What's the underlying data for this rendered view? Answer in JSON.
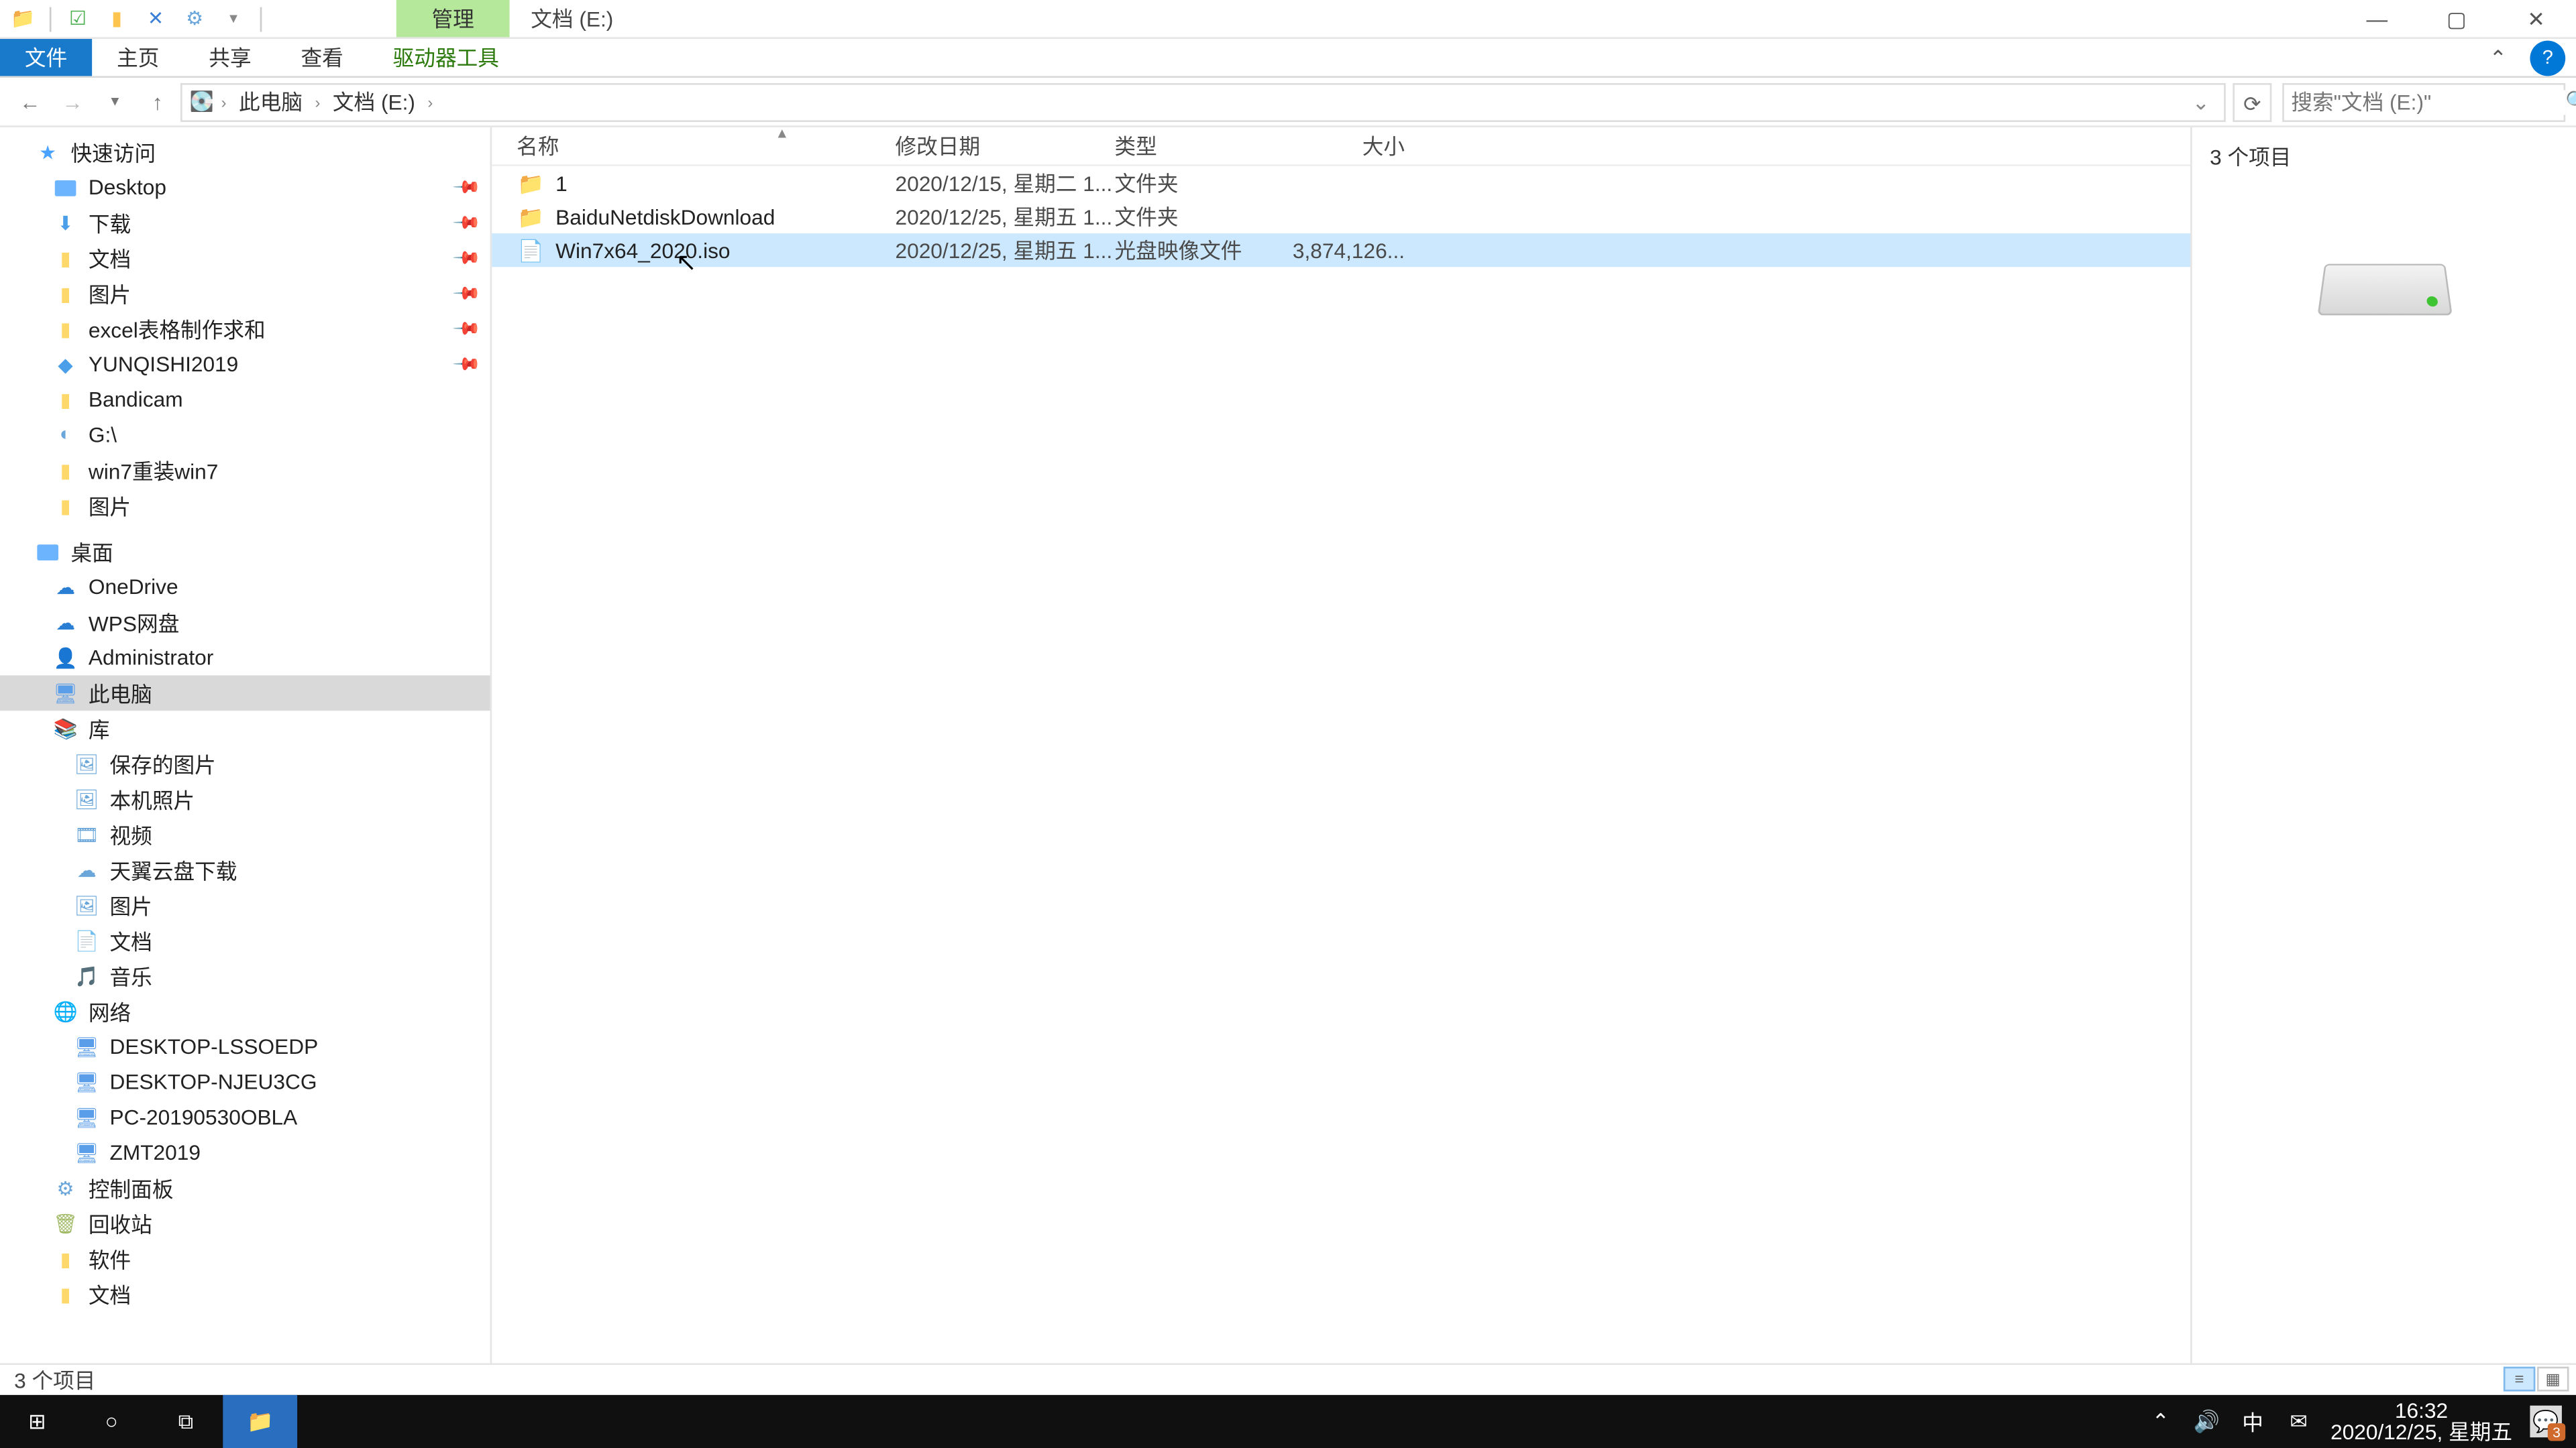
{
  "title": {
    "tab_manage": "管理",
    "path": "文档 (E:)"
  },
  "win": {
    "min": "—",
    "max": "▢",
    "close": "✕",
    "help": "?"
  },
  "qat": {
    "sep": "|",
    "dd": "▾"
  },
  "ribbon": {
    "file": "文件",
    "home": "主页",
    "share": "共享",
    "view": "查看",
    "drive": "驱动器工具",
    "collapse": "⌃"
  },
  "nav": {
    "back": "←",
    "fwd": "→",
    "recent": "▾",
    "up": "↑",
    "crumb_pc": "此电脑",
    "crumb_drive": "文档 (E:)",
    "chev": "›",
    "drop": "⌄",
    "refresh": "⟳"
  },
  "search": {
    "placeholder": "搜索\"文档 (E:)\"",
    "icon": "🔍"
  },
  "tree": {
    "quick": "快速访问",
    "desktop": "Desktop",
    "downloads": "下载",
    "documents": "文档",
    "pictures": "图片",
    "excel": "excel表格制作求和",
    "yunqishi": "YUNQISHI2019",
    "bandicam": "Bandicam",
    "g": "G:\\",
    "win7reinstall": "win7重装win7",
    "pictures2": "图片",
    "desktop_cn": "桌面",
    "onedrive": "OneDrive",
    "wps": "WPS网盘",
    "admin": "Administrator",
    "thispc": "此电脑",
    "lib": "库",
    "savedpics": "保存的图片",
    "localpics": "本机照片",
    "video": "视频",
    "tianyi": "天翼云盘下载",
    "lib_pics": "图片",
    "lib_docs": "文档",
    "music": "音乐",
    "network": "网络",
    "pc1": "DESKTOP-LSSOEDP",
    "pc2": "DESKTOP-NJEU3CG",
    "pc3": "PC-20190530OBLA",
    "pc4": "ZMT2019",
    "ctrl": "控制面板",
    "bin": "回收站",
    "soft": "软件",
    "docs2": "文档"
  },
  "cols": {
    "name": "名称",
    "date": "修改日期",
    "type": "类型",
    "size": "大小",
    "sort": "▲"
  },
  "rows": [
    {
      "icon": "📁",
      "name": "1",
      "date": "2020/12/15, 星期二 1...",
      "type": "文件夹",
      "size": ""
    },
    {
      "icon": "📁",
      "name": "BaiduNetdiskDownload",
      "date": "2020/12/25, 星期五 1...",
      "type": "文件夹",
      "size": ""
    },
    {
      "icon": "📄",
      "name": "Win7x64_2020.iso",
      "date": "2020/12/25, 星期五 1...",
      "type": "光盘映像文件",
      "size": "3,874,126..."
    }
  ],
  "preview": {
    "title": "3 个项目"
  },
  "status": {
    "text": "3 个项目"
  },
  "taskbar": {
    "start": "⊞",
    "search": "○",
    "taskview": "⧉",
    "explorer": "📁",
    "tray_up": "⌃",
    "sound": "🔊",
    "ime": "中",
    "mail": "✉",
    "time": "16:32",
    "date": "2020/12/25, 星期五",
    "notif": "💬",
    "notif_count": "3"
  }
}
